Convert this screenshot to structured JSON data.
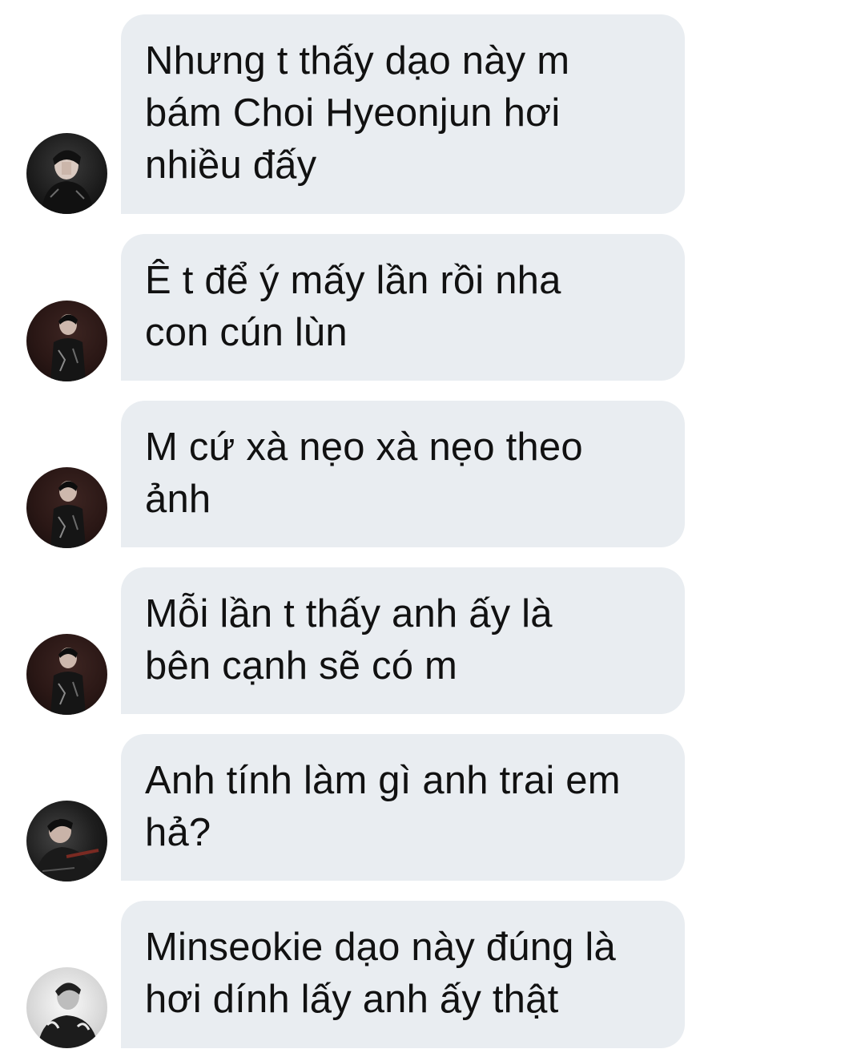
{
  "messages": [
    {
      "text": "Nhưng t thấy dạo này m\nbám Choi Hyeonjun hơi\nnhiều đấy",
      "avatar": "profile-photo"
    },
    {
      "text": "Ê t để ý mấy lần rồi nha\ncon cún lùn",
      "avatar": "profile-photo"
    },
    {
      "text": "M cứ xà nẹo xà nẹo theo\nảnh",
      "avatar": "profile-photo"
    },
    {
      "text": "Mỗi lần t thấy anh ấy là\nbên cạnh sẽ có m",
      "avatar": "profile-photo"
    },
    {
      "text": "Anh tính làm gì anh trai em\nhả?",
      "avatar": "profile-photo"
    },
    {
      "text": "Minseokie dạo này đúng là\nhơi dính lấy anh ấy thật",
      "avatar": "profile-photo"
    }
  ],
  "colors": {
    "bubble": "#e9edf1",
    "text": "#111111",
    "background": "#ffffff"
  }
}
